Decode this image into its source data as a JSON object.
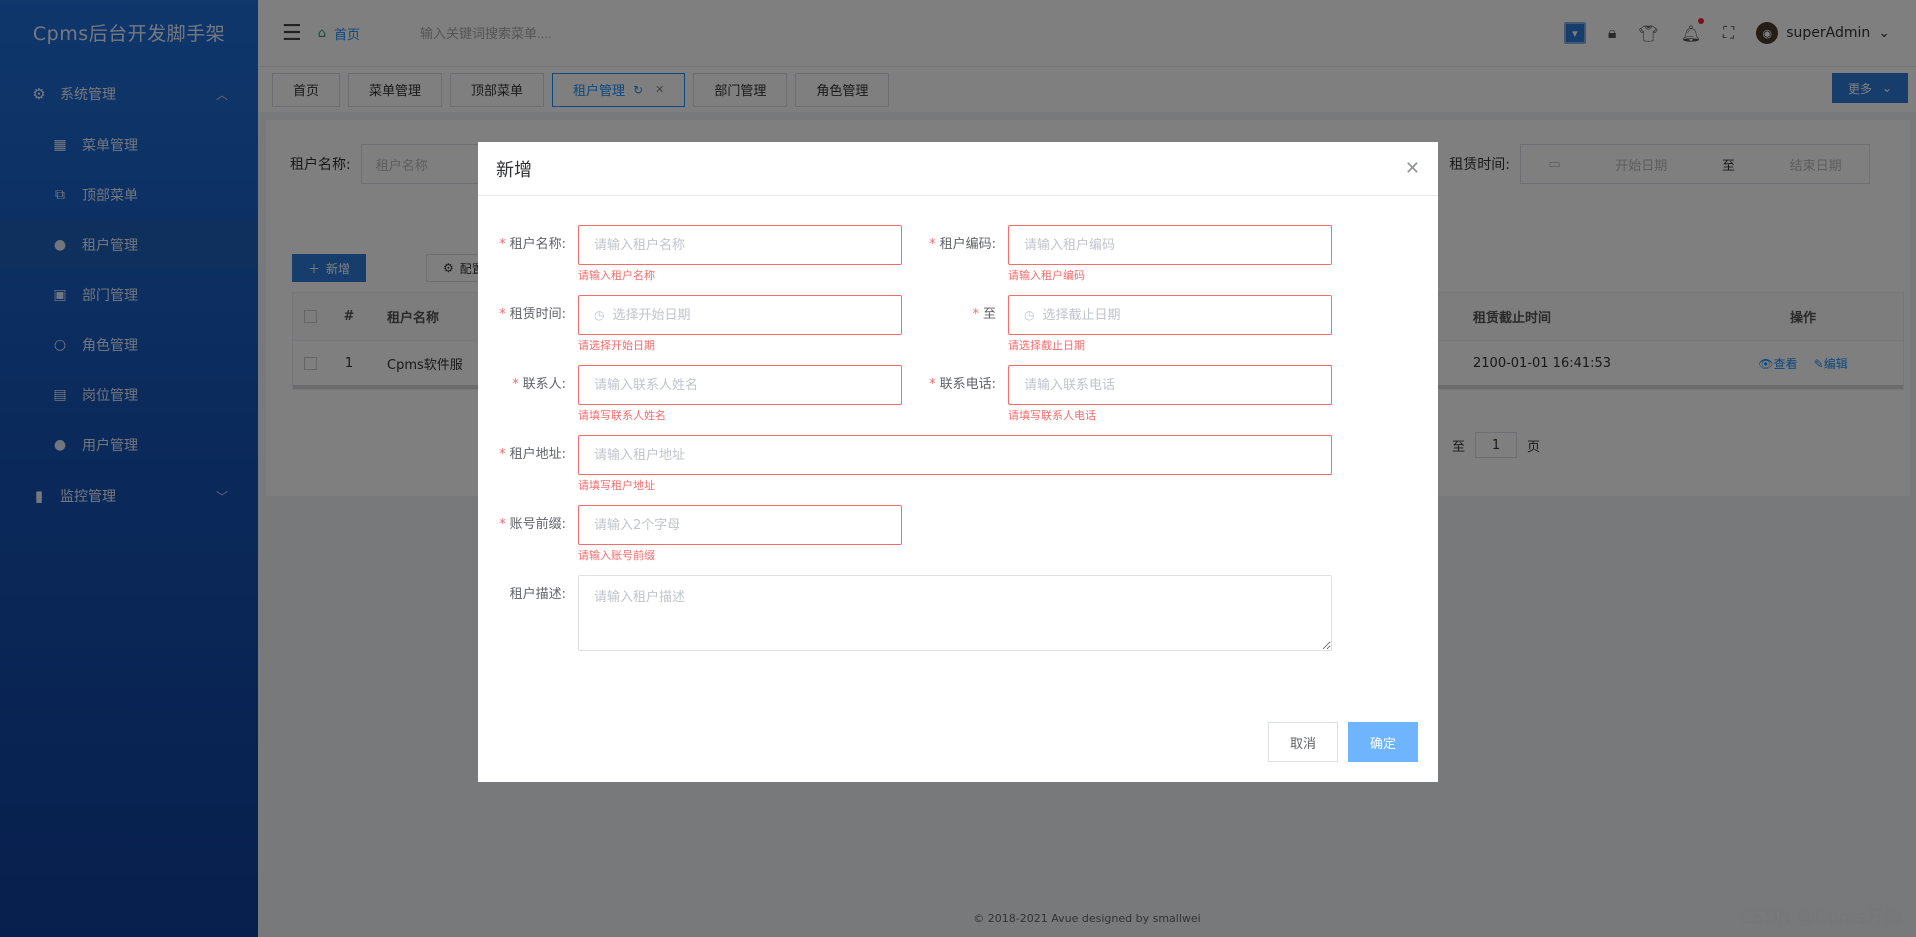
{
  "app": {
    "logo": "Cpms后台开发脚手架"
  },
  "sidebar": {
    "groups": [
      {
        "label": "系统管理",
        "icon": "gear-icon",
        "expanded": true
      },
      {
        "label": "监控管理",
        "icon": "bar-chart-icon",
        "expanded": false
      }
    ],
    "items": [
      {
        "label": "菜单管理",
        "icon": "grid-icon"
      },
      {
        "label": "顶部菜单",
        "icon": "share-icon"
      },
      {
        "label": "租户管理",
        "icon": "user-icon",
        "active": true
      },
      {
        "label": "部门管理",
        "icon": "department-icon"
      },
      {
        "label": "角色管理",
        "icon": "person-icon"
      },
      {
        "label": "岗位管理",
        "icon": "post-icon"
      },
      {
        "label": "用户管理",
        "icon": "user-icon"
      }
    ]
  },
  "header": {
    "breadcrumb": "首页",
    "search_placeholder": "输入关键词搜索菜单....",
    "username": "superAdmin"
  },
  "tabs": [
    {
      "label": "首页"
    },
    {
      "label": "菜单管理"
    },
    {
      "label": "顶部菜单"
    },
    {
      "label": "租户管理",
      "active": true
    },
    {
      "label": "部门管理"
    },
    {
      "label": "角色管理"
    }
  ],
  "more_label": "更多",
  "page": {
    "filter_label": "租户名称:",
    "filter_placeholder": "租户名称",
    "lease_label": "租赁时间:",
    "start_placeholder": "开始日期",
    "to_label": "至",
    "end_placeholder": "结束日期",
    "add_button": "新增",
    "config_button": "配置",
    "table": {
      "headers": {
        "idx": "#",
        "name": "租户名称",
        "end": "租赁截止时间",
        "ops": "操作"
      },
      "rows": [
        {
          "idx": "1",
          "name": "Cpms软件服",
          "end": "2100-01-01 16:41:53",
          "view": "查看",
          "edit": "编辑"
        }
      ]
    },
    "pager_prefix": "至",
    "pager_page": "1",
    "pager_suffix": "页"
  },
  "dialog": {
    "title": "新增",
    "fields": {
      "tenant_name": {
        "label": "租户名称:",
        "placeholder": "请输入租户名称",
        "error": "请输入租户名称"
      },
      "tenant_code": {
        "label": "租户编码:",
        "placeholder": "请输入租户编码",
        "error": "请输入租户编码"
      },
      "lease_start": {
        "label": "租赁时间:",
        "placeholder": "选择开始日期",
        "error": "请选择开始日期"
      },
      "lease_end": {
        "label": "至",
        "placeholder": "选择截止日期",
        "error": "请选择截止日期"
      },
      "contact": {
        "label": "联系人:",
        "placeholder": "请输入联系人姓名",
        "error": "请填写联系人姓名"
      },
      "phone": {
        "label": "联系电话:",
        "placeholder": "请输入联系电话",
        "error": "请填写联系人电话"
      },
      "address": {
        "label": "租户地址:",
        "placeholder": "请输入租户地址",
        "error": "请填写租户地址"
      },
      "prefix": {
        "label": "账号前缀:",
        "placeholder": "请输入2个字母",
        "error": "请输入账号前缀"
      },
      "description": {
        "label": "租户描述:",
        "placeholder": "请输入租户描述"
      }
    },
    "cancel": "取消",
    "confirm": "确定"
  },
  "footer": "© 2018-2021 Avue designed by smallwei",
  "watermark": "CSDN @Cpms开源",
  "colors": {
    "primary": "#1890ff",
    "sidebar": "#1655b8",
    "error": "#f56c6c"
  }
}
